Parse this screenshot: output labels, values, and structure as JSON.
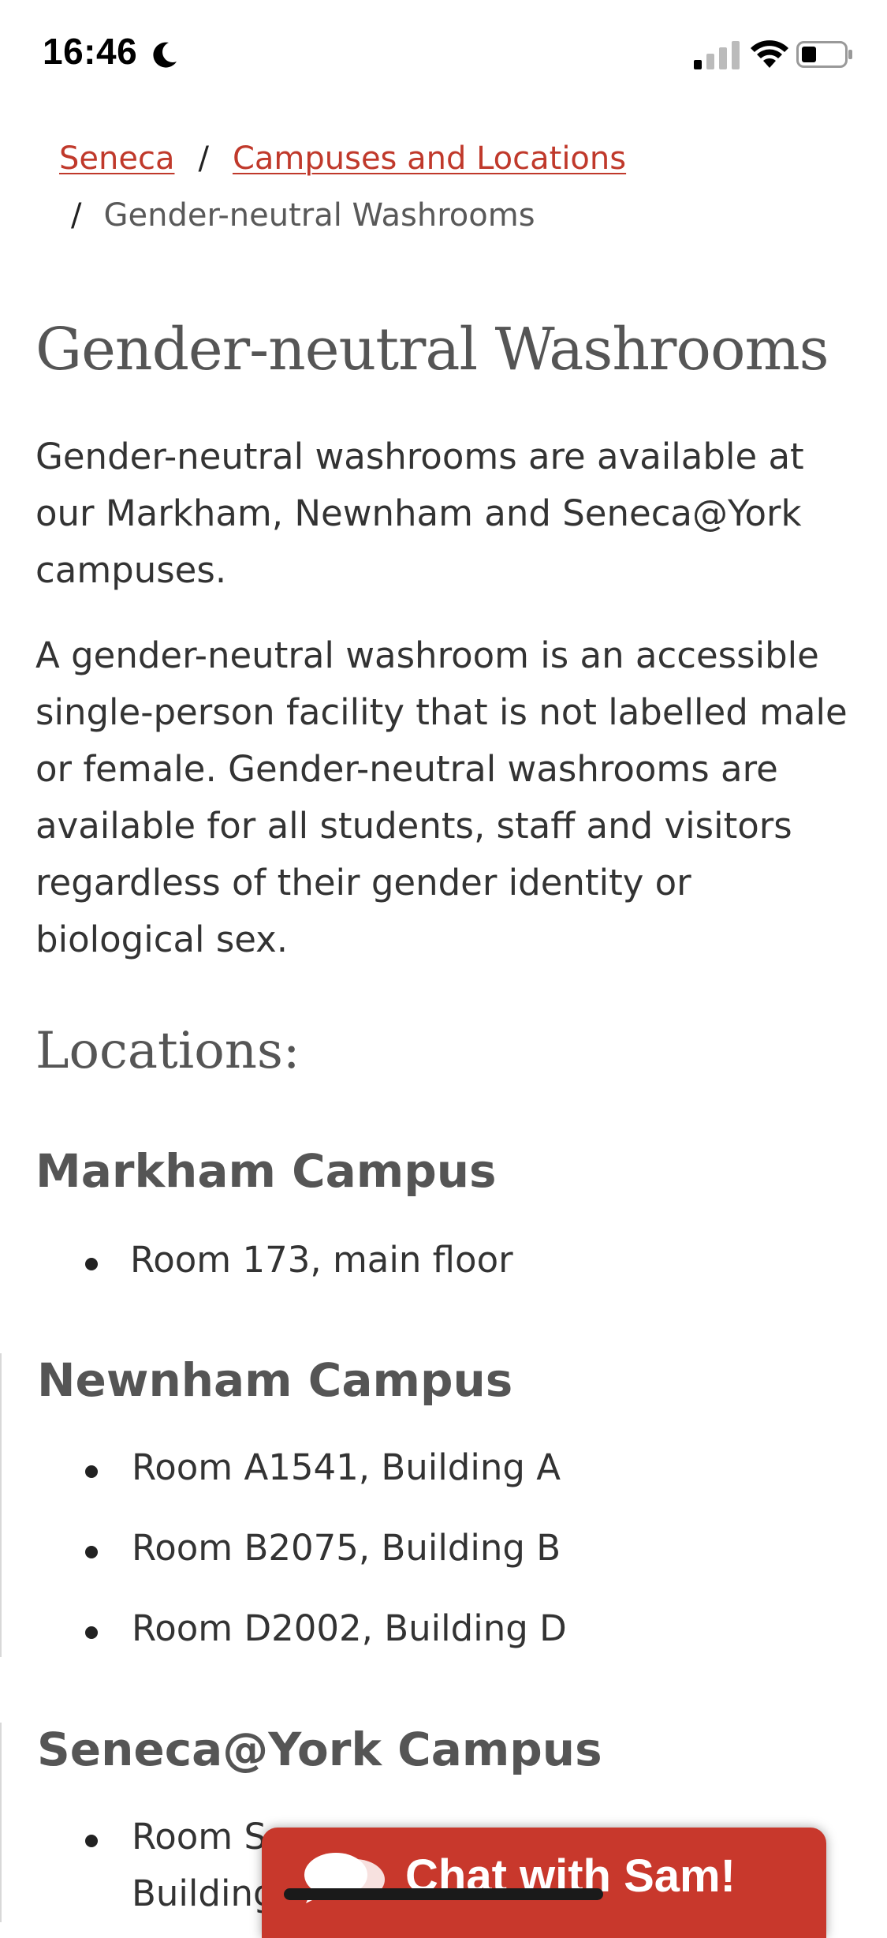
{
  "status_bar": {
    "time": "16:46",
    "icons": [
      "moon-icon",
      "signal-icon",
      "wifi-icon",
      "battery-icon"
    ]
  },
  "breadcrumb": {
    "items": [
      {
        "label": "Seneca",
        "link": true
      },
      {
        "label": "Campuses and Locations",
        "link": true
      },
      {
        "label": "Gender-neutral Washrooms",
        "link": false
      }
    ],
    "separator": "/"
  },
  "page": {
    "title": "Gender-neutral Washrooms",
    "paragraphs": [
      "Gender-neutral washrooms are available at our Markham, Newnham and Seneca@York campuses.",
      "A gender-neutral washroom is an accessible single-person facility that is not labelled male or female. Gender-neutral washrooms are available for all students, staff and visitors regardless of their gender identity or biological sex."
    ],
    "locations_heading": "Locations:"
  },
  "campuses": [
    {
      "name": "Markham Campus",
      "rooms": [
        "Room 173, main floor"
      ]
    },
    {
      "name": "Newnham Campus",
      "rooms": [
        "Room A1541, Building A",
        "Room B2075, Building B",
        "Room D2002, Building D"
      ]
    },
    {
      "name": "Seneca@York Campus",
      "rooms": [
        "Room S",
        "Building"
      ]
    }
  ],
  "chat": {
    "label": "Chat with Sam!",
    "icon": "chat-bubbles-icon"
  },
  "colors": {
    "link": "#c0392b",
    "accent": "#c8382c",
    "heading": "#555555",
    "body_text": "#333333"
  }
}
